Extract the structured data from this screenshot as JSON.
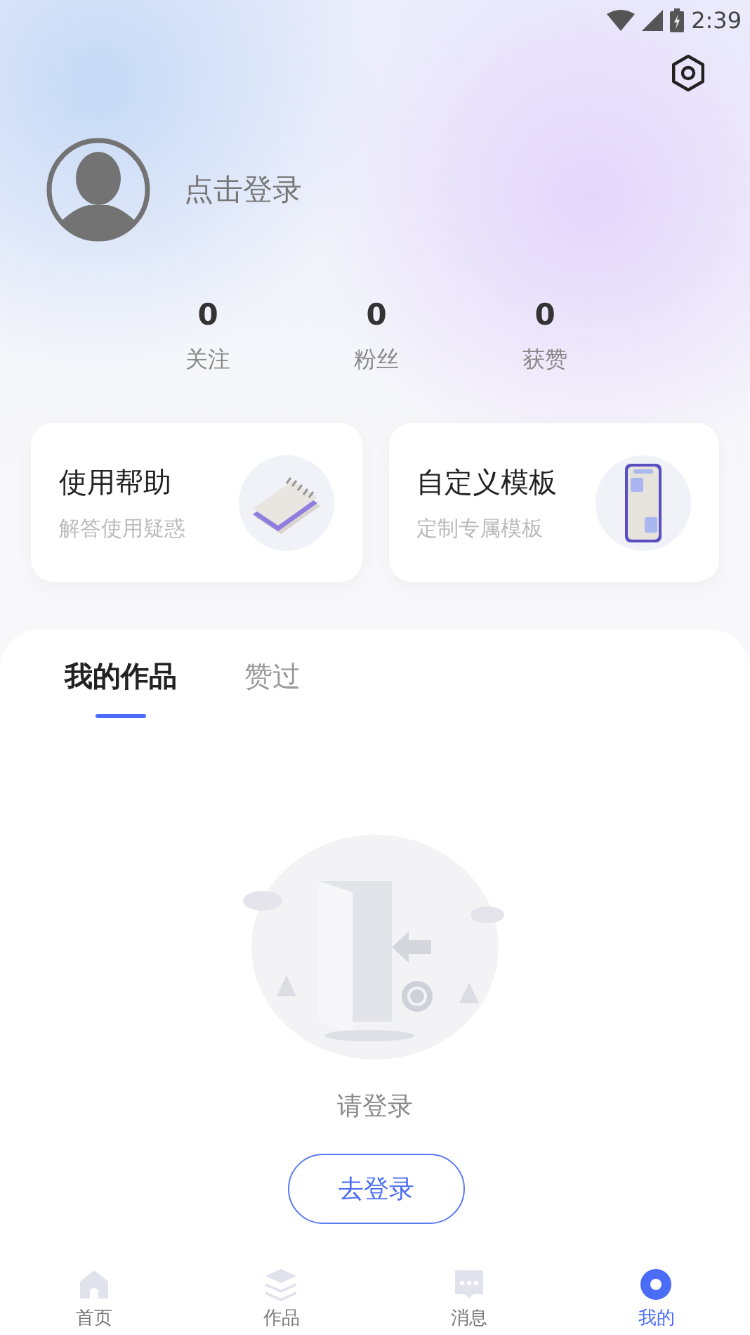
{
  "status_bar": {
    "time": "2:39"
  },
  "profile": {
    "login_prompt": "点击登录"
  },
  "stats": [
    {
      "value": "0",
      "label": "关注"
    },
    {
      "value": "0",
      "label": "粉丝"
    },
    {
      "value": "0",
      "label": "获赞"
    }
  ],
  "cards": [
    {
      "kind": "notebook",
      "title": "使用帮助",
      "subtitle": "解答使用疑惑"
    },
    {
      "kind": "phone",
      "title": "自定义模板",
      "subtitle": "定制专属模板"
    }
  ],
  "tabs": [
    {
      "label": "我的作品",
      "selected": true
    },
    {
      "label": "赞过",
      "selected": false
    }
  ],
  "empty_state": {
    "message": "请登录",
    "button": "去登录"
  },
  "bottom_nav": [
    {
      "kind": "home",
      "label": "首页",
      "selected": false
    },
    {
      "kind": "layers",
      "label": "作品",
      "selected": false
    },
    {
      "kind": "chat",
      "label": "消息",
      "selected": false
    },
    {
      "kind": "profile",
      "label": "我的",
      "selected": true
    }
  ]
}
